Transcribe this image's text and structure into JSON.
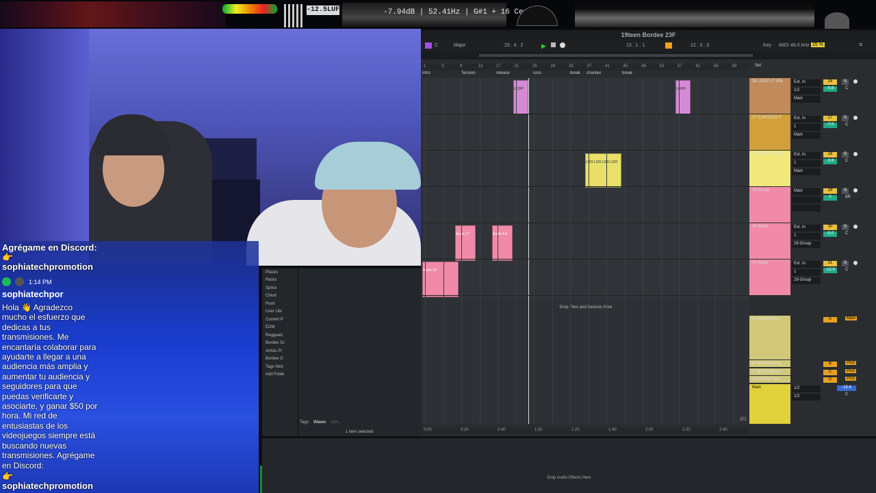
{
  "meter": {
    "lufs": "-12.5LUFS",
    "readout": "-7.94dB | 52.41Hz | G#1 + 16 Cents"
  },
  "chat": {
    "top_line": "Agrégame en Discord:",
    "top_emoji": "👉",
    "top_user": "sophiatechpromotion",
    "time": "1:14 PM",
    "username": "sophiatechpor",
    "message": "Hola 👋 Agradezco mucho el esfuerzo que dedicas a tus transmisiones. Me encantaría colaborar para ayudarte a llegar a una audiencia más amplia y aumentar tu audiencia y seguidores para que puedas verificarte y asociarte, y ganar $50 por hora. Mi red de entusiastas de los videojuegos siempre está buscando nuevas transmisiones. Agrégame en Discord:",
    "bottom_emoji": "👉",
    "bottom_user": "sophiatechpromotion"
  },
  "daw": {
    "title": "19teen Bordee 23F",
    "toolbar": {
      "key": "C",
      "scale": "Major",
      "position": "23 . 4 . 2",
      "loop_start": "13 . 1 . 1",
      "loop_len": "12 . 0 . 0",
      "key_label": "Key",
      "midi_label": "MIDI",
      "sample_rate": "48.0 kHz",
      "cpu": "25 %"
    },
    "ruler": [
      "1",
      "5",
      "9",
      "13",
      "17",
      "21",
      "25",
      "29",
      "33",
      "37",
      "41",
      "45",
      "49",
      "53",
      "57",
      "61",
      "65",
      "69"
    ],
    "set_label": "Set",
    "locators": [
      "intro",
      "Tension",
      "release",
      "coro",
      "break",
      "chanteo",
      "break"
    ],
    "time_ruler": [
      "0:00",
      "0:20",
      "0:40",
      "1:00",
      "1:20",
      "1:40",
      "2:00",
      "2:20",
      "2:40"
    ],
    "page": "2/1",
    "drop_files": "Drop Files and Devices Here",
    "tracks": [
      {
        "name": "26 LOOP 27 89b",
        "color": "#c08a5a",
        "num": "26",
        "io": "Ext. In",
        "ch": "1/2",
        "out": "Main",
        "vol": "-0.8",
        "pan": "C"
      },
      {
        "name": "27 CAMTAZO 3",
        "color": "#d2a03a",
        "num": "27",
        "io": "Ext. In",
        "ch": "1",
        "out": "Main",
        "vol": "-7.0",
        "pan": "C"
      },
      {
        "name": "28 LOOP 2 90bp",
        "color": "#f0e87a",
        "num": "28",
        "io": "Ext. In",
        "ch": "1",
        "out": "Main",
        "vol": "-3.8",
        "pan": "C"
      },
      {
        "name": "29 Group",
        "color": "#f08aa8",
        "num": "29",
        "io": "Main",
        "ch": "",
        "out": "",
        "vol": "0",
        "pan": "5R"
      },
      {
        "name": "30 Audio",
        "color": "#f08aa8",
        "num": "30",
        "io": "Ext. In",
        "ch": "1",
        "out": "29-Group",
        "vol": "-5.0",
        "pan": "C"
      },
      {
        "name": "31 Audio",
        "color": "#f08aa8",
        "num": "31",
        "io": "Ext. In",
        "ch": "1",
        "out": "29-Group",
        "vol": "-12.0",
        "pan": "C"
      }
    ],
    "returns": [
      {
        "name": "A ValhallaVinta",
        "color": "#d2c87a",
        "letter": "A",
        "io": "Main"
      },
      {
        "name": "B ValhallaDelay",
        "color": "#d2c87a",
        "letter": "B",
        "io": "Post"
      },
      {
        "name": "C 4th Bandpass",
        "color": "#d2c87a",
        "letter": "C",
        "io": "Post"
      },
      {
        "name": "D H-Delay Ster",
        "color": "#d2c87a",
        "letter": "D",
        "io": "Post"
      }
    ],
    "master": {
      "name": "Main",
      "color": "#e0d23a",
      "ch1": "1/2",
      "ch2": "1/2",
      "vol": "-15.4",
      "pan": "C"
    },
    "clips": {
      "loop_a": "LOOP",
      "loop2": "LOO LOO LOO LOO",
      "audio17": "Audio 17",
      "audio4": "Audio 4 A",
      "audio10": "Audio 10"
    }
  },
  "browser": {
    "places_label": "Places",
    "items": [
      "Packs",
      "Splice",
      "Cloud",
      "Push",
      "User Libr",
      "Current P",
      "EDM",
      "Reggeatc",
      "Bordee Sc",
      "Artists Pr",
      "Bordee O",
      "Tags Nick",
      "Add Folde"
    ],
    "tags_label": "Tags:",
    "tags_value": "Waves",
    "tags_add": "Add...",
    "selection": "1 item selected"
  },
  "bottom": {
    "message": "Drop Audio Effects Here"
  }
}
